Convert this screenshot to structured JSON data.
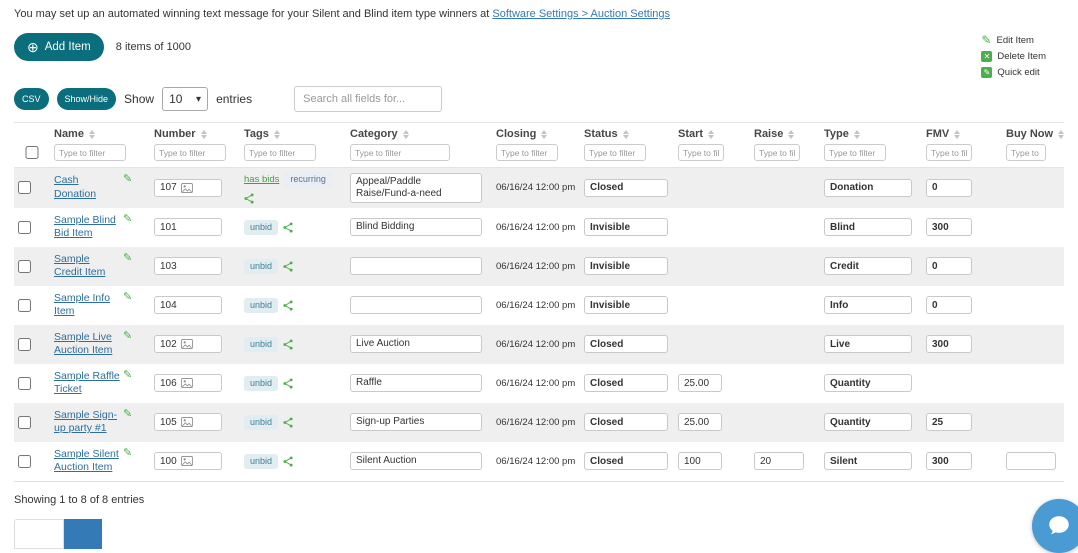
{
  "colors": {
    "accent_teal": "#0a6e7c",
    "link_blue": "#337ab7",
    "name_link": "#2e6e9e",
    "green": "#4cae4c",
    "badge_bg": "#e2edf2",
    "badge_text": "#3d7f93",
    "row_stripe": "#efefef",
    "pagination_active": "#337ab7",
    "chat_blue": "#4a9ad4"
  },
  "icons": {
    "add": "⊕",
    "pencil": "✎",
    "delete": "✕",
    "caret": "▾"
  },
  "notice": {
    "text": "You may set up an automated winning text message for your Silent and Blind item type winners at ",
    "link_text": "Software Settings > Auction Settings"
  },
  "toolbar": {
    "add_item_label": "Add Item",
    "items_count": "8 items of 1000",
    "legend": [
      {
        "label": "Edit Item",
        "icon": "pencil-outline"
      },
      {
        "label": "Delete Item",
        "icon": "trash-square"
      },
      {
        "label": "Quick edit",
        "icon": "pencil-square"
      }
    ]
  },
  "controls": {
    "csv_label": "CSV",
    "show_hide_label": "Show/Hide",
    "show_label": "Show",
    "entries_value": "10",
    "entries_label": "entries",
    "search_placeholder": "Search all fields for..."
  },
  "table": {
    "columns": [
      {
        "label": "Name",
        "filter_placeholder": "Type to filter"
      },
      {
        "label": "Number",
        "filter_placeholder": "Type to filter"
      },
      {
        "label": "Tags",
        "filter_placeholder": "Type to filter"
      },
      {
        "label": "Category",
        "filter_placeholder": "Type to filter"
      },
      {
        "label": "Closing",
        "filter_placeholder": "Type to filter"
      },
      {
        "label": "Status",
        "filter_placeholder": "Type to filter"
      },
      {
        "label": "Start",
        "filter_placeholder": "Type to filter"
      },
      {
        "label": "Raise",
        "filter_placeholder": "Type to filter"
      },
      {
        "label": "Type",
        "filter_placeholder": "Type to filter"
      },
      {
        "label": "FMV",
        "filter_placeholder": "Type to filter"
      },
      {
        "label": "Buy Now",
        "filter_placeholder": "Type to filter"
      }
    ],
    "rows": [
      {
        "name": "Cash Donation",
        "number": "107",
        "number_has_image": true,
        "bid_status": "has bids",
        "recurring": "recurring",
        "category": "Appeal/Paddle Raise/Fund-a-need",
        "closing": "06/16/24 12:00 pm",
        "status": "Closed",
        "start": null,
        "raise": null,
        "type": "Donation",
        "fmv": "0",
        "buy_now": null
      },
      {
        "name": "Sample Blind Bid Item",
        "number": "101",
        "number_has_image": false,
        "bid_status": "unbid",
        "recurring": null,
        "category": "Blind Bidding",
        "closing": "06/16/24 12:00 pm",
        "status": "Invisible",
        "start": null,
        "raise": null,
        "type": "Blind",
        "fmv": "300",
        "buy_now": null
      },
      {
        "name": "Sample Credit Item",
        "number": "103",
        "number_has_image": false,
        "bid_status": "unbid",
        "recurring": null,
        "category": "",
        "closing": "06/16/24 12:00 pm",
        "status": "Invisible",
        "start": null,
        "raise": null,
        "type": "Credit",
        "fmv": "0",
        "buy_now": null
      },
      {
        "name": "Sample Info Item",
        "number": "104",
        "number_has_image": false,
        "bid_status": "unbid",
        "recurring": null,
        "category": "",
        "closing": "06/16/24 12:00 pm",
        "status": "Invisible",
        "start": null,
        "raise": null,
        "type": "Info",
        "fmv": "0",
        "buy_now": null
      },
      {
        "name": "Sample Live Auction Item",
        "number": "102",
        "number_has_image": true,
        "bid_status": "unbid",
        "recurring": null,
        "category": "Live Auction",
        "closing": "06/16/24 12:00 pm",
        "status": "Closed",
        "start": null,
        "raise": null,
        "type": "Live",
        "fmv": "300",
        "buy_now": null
      },
      {
        "name": "Sample Raffle Ticket",
        "number": "106",
        "number_has_image": true,
        "bid_status": "unbid",
        "recurring": null,
        "category": "Raffle",
        "closing": "06/16/24 12:00 pm",
        "status": "Closed",
        "start": "25.00",
        "raise": null,
        "type": "Quantity",
        "fmv": null,
        "buy_now": null
      },
      {
        "name": "Sample Sign-up party #1",
        "number": "105",
        "number_has_image": true,
        "bid_status": "unbid",
        "recurring": null,
        "category": "Sign-up Parties",
        "closing": "06/16/24 12:00 pm",
        "status": "Closed",
        "start": "25.00",
        "raise": null,
        "type": "Quantity",
        "fmv": "25",
        "buy_now": null
      },
      {
        "name": "Sample Silent Auction Item",
        "number": "100",
        "number_has_image": true,
        "bid_status": "unbid",
        "recurring": null,
        "category": "Silent Auction",
        "closing": "06/16/24 12:00 pm",
        "status": "Closed",
        "start": "100",
        "raise": "20",
        "type": "Silent",
        "fmv": "300",
        "buy_now": ""
      }
    ],
    "footer": "Showing 1 to 8 of 8 entries"
  }
}
